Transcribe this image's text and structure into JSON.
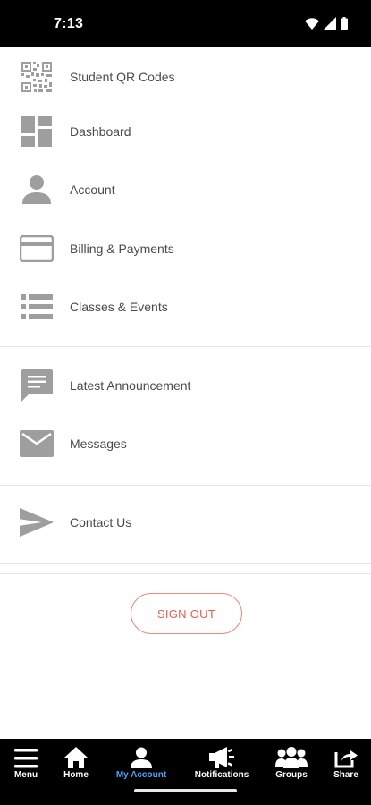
{
  "status_bar": {
    "time": "7:13"
  },
  "menu": {
    "items": [
      {
        "label": "Student QR Codes",
        "icon": "qr-code-icon"
      },
      {
        "label": "Dashboard",
        "icon": "dashboard-icon"
      },
      {
        "label": "Account",
        "icon": "person-icon"
      },
      {
        "label": "Billing & Payments",
        "icon": "credit-card-icon"
      },
      {
        "label": "Classes & Events",
        "icon": "list-icon"
      },
      {
        "label": "Latest Announcement",
        "icon": "announcement-icon"
      },
      {
        "label": "Messages",
        "icon": "mail-icon"
      },
      {
        "label": "Contact Us",
        "icon": "send-icon"
      }
    ]
  },
  "sign_out": {
    "label": "SIGN OUT"
  },
  "bottom_nav": {
    "active": "My Account",
    "items": [
      {
        "label": "Menu",
        "icon": "hamburger-icon"
      },
      {
        "label": "Home",
        "icon": "home-icon"
      },
      {
        "label": "My Account",
        "icon": "account-icon"
      },
      {
        "label": "Notifications",
        "icon": "megaphone-icon"
      },
      {
        "label": "Groups",
        "icon": "groups-icon"
      },
      {
        "label": "Share",
        "icon": "share-icon"
      }
    ]
  },
  "colors": {
    "icon_gray": "#9e9e9e",
    "label_text": "#4a4a4a",
    "sign_out_accent": "#e06050",
    "active_nav": "#4aa3ff",
    "bar_background": "#000000"
  }
}
